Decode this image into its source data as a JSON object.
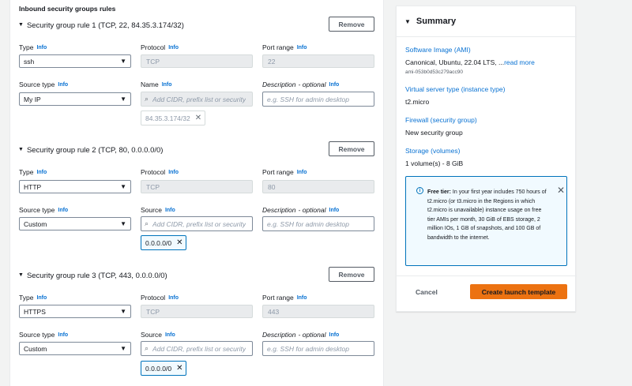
{
  "section_title": "Inbound security groups rules",
  "labels": {
    "type": "Type",
    "protocol": "Protocol",
    "port_range": "Port range",
    "source_type": "Source type",
    "name": "Name",
    "source": "Source",
    "description": "Description",
    "optional": "- optional",
    "info": "Info",
    "remove": "Remove",
    "cidr_placeholder": "Add CIDR, prefix list or security",
    "desc_placeholder": "e.g. SSH for admin desktop"
  },
  "rules": [
    {
      "title": "Security group rule 1 (TCP, 22, 84.35.3.174/32)",
      "type": "ssh",
      "protocol": "TCP",
      "port": "22",
      "source_type": "My IP",
      "token": "84.35.3.174/32"
    },
    {
      "title": "Security group rule 2 (TCP, 80, 0.0.0.0/0)",
      "type": "HTTP",
      "protocol": "TCP",
      "port": "80",
      "source_type": "Custom",
      "token": "0.0.0.0/0"
    },
    {
      "title": "Security group rule 3 (TCP, 443, 0.0.0.0/0)",
      "type": "HTTPS",
      "protocol": "TCP",
      "port": "443",
      "source_type": "Custom",
      "token": "0.0.0.0/0"
    }
  ],
  "summary": {
    "title": "Summary",
    "ami_label": "Software Image (AMI)",
    "ami_value": "Canonical, Ubuntu, 22.04 LTS, ...",
    "read_more": "read more",
    "ami_id": "ami-053b0d53c279acc90",
    "instance_label": "Virtual server type (instance type)",
    "instance_value": "t2.micro",
    "firewall_label": "Firewall (security group)",
    "firewall_value": "New security group",
    "storage_label": "Storage (volumes)",
    "storage_value": "1 volume(s) - 8 GiB",
    "free_tier_title": "Free tier:",
    "free_tier_text": "In your first year includes 750 hours of t2.micro (or t3.micro in the Regions in which t2.micro is unavailable) instance usage on free tier AMIs per month, 30 GiB of EBS storage, 2 million IOs, 1 GB of snapshots, and 100 GB of bandwidth to the internet.",
    "cancel": "Cancel",
    "create": "Create launch template"
  },
  "colors": {
    "accent": "#0972d3",
    "primary_button": "#ec7211",
    "info_panel_bg": "#f1faff"
  }
}
